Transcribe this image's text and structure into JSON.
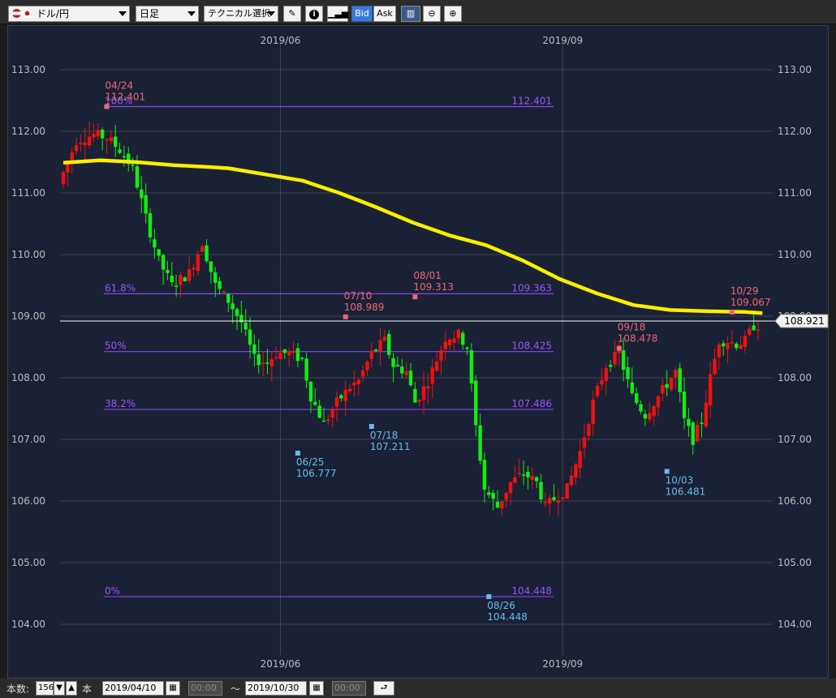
{
  "toolbar": {
    "pair": "ドル/円",
    "period": "日足",
    "technical": "テクニカル選択",
    "bid": "Bid",
    "ask": "Ask"
  },
  "bottom": {
    "count_label": "本数:",
    "count_value": "156",
    "unit_label": "本",
    "from_date": "2019/04/10",
    "from_time": "00:00",
    "tilde": "〜",
    "to_date": "2019/10/30",
    "to_time": "00:00"
  },
  "colors": {
    "bg": "#1a2134",
    "grid": "#3c4252",
    "up": "#ee1111",
    "down": "#11ee11",
    "ma": "#ffee00",
    "fib": "#8844ee",
    "fib_text": "#9955ff",
    "high_marker": "#ee6677",
    "low_marker": "#66bbee"
  },
  "chart_data": {
    "type": "candlestick",
    "ylim": [
      103.5,
      113.6
    ],
    "yticks": [
      "113.00",
      "112.00",
      "111.00",
      "110.00",
      "109.00",
      "108.00",
      "107.00",
      "106.00",
      "105.00",
      "104.00"
    ],
    "ytick_values": [
      113,
      112,
      111,
      110,
      109,
      108,
      107,
      106,
      105,
      104
    ],
    "xtick_labels": [
      "2019/06",
      "2019/09"
    ],
    "xtick_index": [
      50,
      115
    ],
    "current_price": "108.921",
    "current_value": 108.921,
    "fib_levels": [
      {
        "label": "100%",
        "value_label": "112.401",
        "value": 112.401
      },
      {
        "label": "61.8%",
        "value_label": "109.363",
        "value": 109.363
      },
      {
        "label": "50%",
        "value_label": "108.425",
        "value": 108.425
      },
      {
        "label": "38.2%",
        "value_label": "107.486",
        "value": 107.486
      },
      {
        "label": "0%",
        "value_label": "104.448",
        "value": 104.448
      }
    ],
    "markers": [
      {
        "date": "04/24",
        "price": "112.401",
        "index": 10,
        "value": 112.401,
        "kind": "high"
      },
      {
        "date": "07/10",
        "price": "108.989",
        "index": 65,
        "value": 108.989,
        "kind": "high"
      },
      {
        "date": "08/01",
        "price": "109.313",
        "index": 81,
        "value": 109.313,
        "kind": "high"
      },
      {
        "date": "09/18",
        "price": "108.478",
        "index": 128,
        "value": 108.478,
        "kind": "high"
      },
      {
        "date": "10/29",
        "price": "109.067",
        "index": 154,
        "value": 109.067,
        "kind": "high"
      },
      {
        "date": "06/25",
        "price": "106.777",
        "index": 54,
        "value": 106.777,
        "kind": "low"
      },
      {
        "date": "07/18",
        "price": "107.211",
        "index": 71,
        "value": 107.211,
        "kind": "low"
      },
      {
        "date": "08/26",
        "price": "104.448",
        "index": 98,
        "value": 104.448,
        "kind": "low"
      },
      {
        "date": "10/03",
        "price": "106.481",
        "index": 139,
        "value": 106.481,
        "kind": "low"
      }
    ],
    "ma_points": [
      [
        0,
        111.49
      ],
      [
        10,
        111.53
      ],
      [
        20,
        111.5
      ],
      [
        30,
        111.45
      ],
      [
        40,
        111.42
      ],
      [
        45,
        111.4
      ],
      [
        55,
        111.3
      ],
      [
        65,
        111.2
      ],
      [
        75,
        111.0
      ],
      [
        85,
        110.77
      ],
      [
        95,
        110.52
      ],
      [
        105,
        110.31
      ],
      [
        115,
        110.15
      ],
      [
        125,
        109.9
      ],
      [
        135,
        109.6
      ],
      [
        145,
        109.37
      ],
      [
        155,
        109.18
      ],
      [
        165,
        109.1
      ],
      [
        175,
        109.08
      ],
      [
        185,
        109.07
      ],
      [
        190,
        109.05
      ]
    ],
    "candles_anchor": [
      [
        0,
        111.15
      ],
      [
        4,
        111.85
      ],
      [
        8,
        111.95
      ],
      [
        11,
        111.9
      ],
      [
        14,
        111.7
      ],
      [
        17,
        111.4
      ],
      [
        20,
        110.6
      ],
      [
        23,
        109.9
      ],
      [
        26,
        109.5
      ],
      [
        30,
        109.7
      ],
      [
        33,
        110.2
      ],
      [
        36,
        109.5
      ],
      [
        39,
        109.25
      ],
      [
        42,
        108.9
      ],
      [
        45,
        108.3
      ],
      [
        48,
        108.25
      ],
      [
        50,
        108.4
      ],
      [
        53,
        108.4
      ],
      [
        56,
        108.3
      ],
      [
        58,
        107.7
      ],
      [
        61,
        107.25
      ],
      [
        64,
        107.6
      ],
      [
        67,
        107.85
      ],
      [
        69,
        107.95
      ],
      [
        72,
        108.4
      ],
      [
        75,
        108.6
      ],
      [
        77,
        108.2
      ],
      [
        80,
        108.1
      ],
      [
        82,
        107.6
      ],
      [
        85,
        107.95
      ],
      [
        87,
        108.3
      ],
      [
        89,
        108.65
      ],
      [
        92,
        108.7
      ],
      [
        94,
        108.5
      ],
      [
        96,
        107.2
      ],
      [
        98,
        106.2
      ],
      [
        101,
        105.9
      ],
      [
        104,
        106.3
      ],
      [
        107,
        106.45
      ],
      [
        110,
        106.3
      ],
      [
        112,
        105.9
      ],
      [
        115,
        106.1
      ],
      [
        117,
        106.2
      ],
      [
        120,
        106.8
      ],
      [
        123,
        107.6
      ],
      [
        126,
        108.2
      ],
      [
        129,
        108.4
      ],
      [
        132,
        107.7
      ],
      [
        135,
        107.4
      ],
      [
        137,
        107.6
      ],
      [
        140,
        107.9
      ],
      [
        142,
        108.1
      ],
      [
        144,
        107.3
      ],
      [
        146,
        107.0
      ],
      [
        148,
        107.3
      ],
      [
        150,
        108.0
      ],
      [
        152,
        108.6
      ],
      [
        154,
        108.6
      ],
      [
        156,
        108.55
      ],
      [
        158,
        108.6
      ],
      [
        160,
        108.85
      ]
    ]
  }
}
